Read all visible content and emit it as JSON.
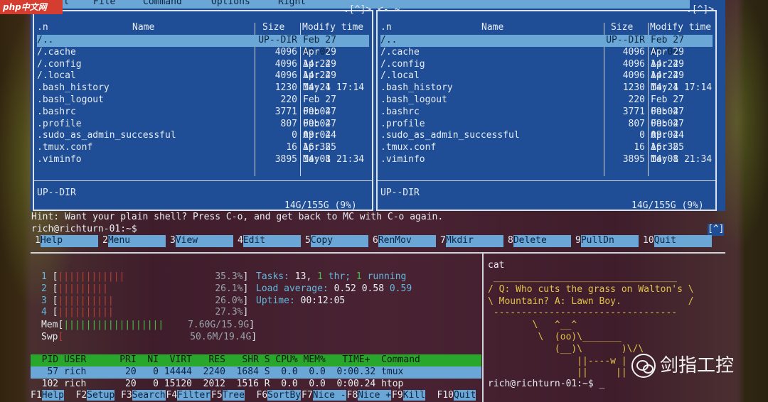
{
  "watermark_logo": "php中文网",
  "watermark_brand": "剑指工控",
  "mc": {
    "menu": [
      "Left",
      "File",
      "Command",
      "Options",
      "Right"
    ],
    "left_path_tail": ".[^]>",
    "right_path_head": "<- ~",
    "right_path_tail": ".[^]>",
    "col_sort": ".n",
    "col_name": "Name",
    "col_size": "Size",
    "col_mtime": "Modify time",
    "files": [
      {
        "name": "/..",
        "size": "UP--DIR",
        "mtime": "Feb 27 09:04"
      },
      {
        "name": "/.cache",
        "size": "4096",
        "mtime": "Apr 29 14:24"
      },
      {
        "name": "/.config",
        "size": "4096",
        "mtime": "Apr 29 14:24"
      },
      {
        "name": "/.local",
        "size": "4096",
        "mtime": "Apr 29 14:24"
      },
      {
        "name": " .bash_history",
        "size": "1230",
        "mtime": "May  1 17:14"
      },
      {
        "name": " .bash_logout",
        "size": "220",
        "mtime": "Feb 27 09:04"
      },
      {
        "name": " .bashrc",
        "size": "3771",
        "mtime": "Feb 27 09:04"
      },
      {
        "name": " .profile",
        "size": "807",
        "mtime": "Feb 27 09:04"
      },
      {
        "name": " .sudo_as_admin_successful",
        "size": "0",
        "mtime": "Apr 24 16:38"
      },
      {
        "name": " .tmux.conf",
        "size": "16",
        "mtime": "Apr 25 14:08"
      },
      {
        "name": " .viminfo",
        "size": "3895",
        "mtime": "May  1 21:34"
      }
    ],
    "left_status": "UP--DIR",
    "right_status": "UP--DIR",
    "left_disk": "14G/155G (9%)",
    "right_disk": "14G/155G (9%)",
    "hint": "Hint: Want your plain shell? Press C-o, and get back to MC with C-o again.",
    "prompt": "rich@richturn-01:~$",
    "prompt_right": "[^]",
    "fkeys": [
      {
        "n": "1",
        "label": "Help"
      },
      {
        "n": "2",
        "label": "Menu"
      },
      {
        "n": "3",
        "label": "View"
      },
      {
        "n": "4",
        "label": "Edit"
      },
      {
        "n": "5",
        "label": "Copy"
      },
      {
        "n": "6",
        "label": "RenMov"
      },
      {
        "n": "7",
        "label": "Mkdir"
      },
      {
        "n": "8",
        "label": "Delete"
      },
      {
        "n": "9",
        "label": "PullDn"
      },
      {
        "n": "10",
        "label": "Quit"
      }
    ]
  },
  "htop": {
    "cpus": [
      {
        "id": "1",
        "bar": "||||||||||||",
        "pct": "35.3%"
      },
      {
        "id": "2",
        "bar": "|||||||||",
        "pct": "26.1%"
      },
      {
        "id": "3",
        "bar": "||||||||||",
        "pct": "26.0%"
      },
      {
        "id": "4",
        "bar": "||||||||||",
        "pct": "27.3%"
      }
    ],
    "mem_label": "Mem",
    "mem_bar": "||||||||||||||||||",
    "mem_val": "7.60G/15.9G",
    "swp_label": "Swp",
    "swp_val": "50.6M/19.4G",
    "tasks_label": "Tasks:",
    "tasks_n": "13,",
    "thr_n": "1",
    "thr_label": "thr;",
    "run_n": "1",
    "run_label": "running",
    "load_label": "Load average:",
    "load1": "0.52",
    "load5": "0.58",
    "load15": "0.59",
    "uptime_label": "Uptime:",
    "uptime": "00:12:05",
    "header": "  PID USER      PRI  NI  VIRT   RES   SHR S CPU% MEM%   TIME+  Command",
    "procs": [
      "   57 rich       20   0 14444  2240  1684 S  0.0  0.0  0:00.32 tmux",
      "  102 rich       20   0 15120  2012  1516 R  0.0  0.0  0:00.24 htop"
    ],
    "fkeys": [
      {
        "n": "F1",
        "label": "Help"
      },
      {
        "n": "F2",
        "label": "Setup"
      },
      {
        "n": "F3",
        "label": "Search"
      },
      {
        "n": "F4",
        "label": "Filter"
      },
      {
        "n": "F5",
        "label": "Tree"
      },
      {
        "n": "F6",
        "label": "SortBy"
      },
      {
        "n": "F7",
        "label": "Nice -"
      },
      {
        "n": "F8",
        "label": "Nice +"
      },
      {
        "n": "F9",
        "label": "Kill"
      },
      {
        "n": "F10",
        "label": "Quit"
      }
    ]
  },
  "cowsay": {
    "command": "cat",
    "lines": [
      " _________________________________",
      "/ Q: Who cuts the grass on Walton's \\",
      "\\ Mountain? A: Lawn Boy.            /",
      " ---------------------------------",
      "        \\   ^__^",
      "         \\  (oo)\\_______",
      "            (__)\\       )\\/\\",
      "                ||----w |",
      "                ||     ||"
    ],
    "prompt": "rich@richturn-01:~$ _"
  }
}
